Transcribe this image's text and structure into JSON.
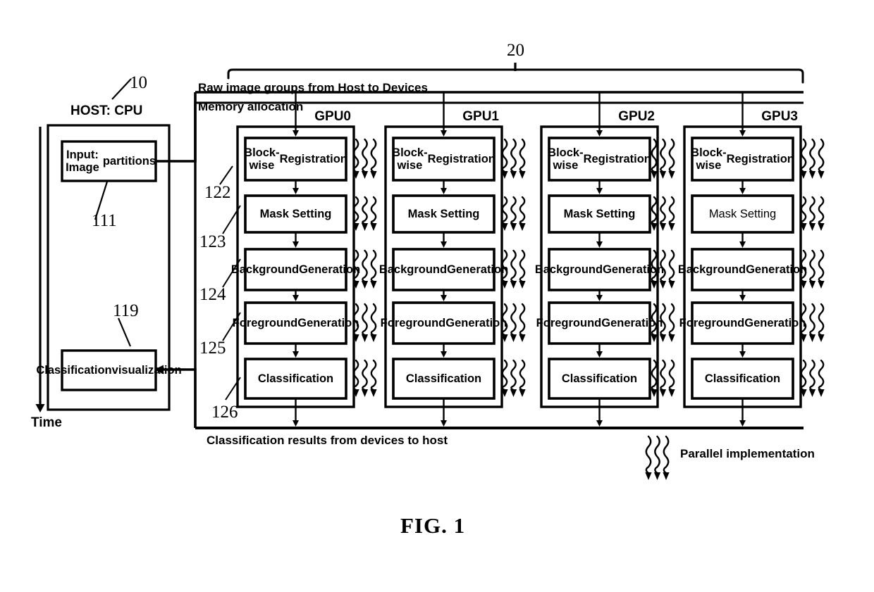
{
  "figure": {
    "caption": "FIG. 1",
    "top_bracket_ref": "20",
    "host_ref": "10"
  },
  "host": {
    "title": "HOST: CPU",
    "time_axis_label": "Time",
    "blocks": [
      {
        "label": "Input: Image\npartitions",
        "ref": "111"
      },
      {
        "label": "Classification\nvisualization",
        "ref": "119"
      }
    ]
  },
  "bus": {
    "top_label": "Raw image groups from Host to Devices",
    "memory_label": "Memory allocation",
    "bottom_label": "Classification results from devices to host"
  },
  "legend": {
    "parallel_label": "Parallel implementation",
    "parallel_icon": "wavy-arrows-icon"
  },
  "stage_refs": [
    "122",
    "123",
    "124",
    "125",
    "126"
  ],
  "gpus": [
    {
      "name": "GPU0",
      "stages": [
        {
          "label": "Block-wise\nRegistration",
          "weight": "bold"
        },
        {
          "label": "Mask Setting",
          "weight": "bold"
        },
        {
          "label": "Background\nGeneration",
          "weight": "bold"
        },
        {
          "label": "Foreground\nGeneration",
          "weight": "bold"
        },
        {
          "label": "Classification",
          "weight": "bold"
        }
      ]
    },
    {
      "name": "GPU1",
      "stages": [
        {
          "label": "Block-wise\nRegistration",
          "weight": "bold"
        },
        {
          "label": "Mask Setting",
          "weight": "bold"
        },
        {
          "label": "Background\nGeneration",
          "weight": "bold"
        },
        {
          "label": "Foreground\nGeneration",
          "weight": "bold"
        },
        {
          "label": "Classification",
          "weight": "bold"
        }
      ]
    },
    {
      "name": "GPU2",
      "stages": [
        {
          "label": "Block-wise\nRegistration",
          "weight": "bold"
        },
        {
          "label": "Mask Setting",
          "weight": "bold"
        },
        {
          "label": "Background\nGeneration",
          "weight": "bold"
        },
        {
          "label": "Foreground\nGeneration",
          "weight": "bold"
        },
        {
          "label": "Classification",
          "weight": "bold"
        }
      ]
    },
    {
      "name": "GPU3",
      "stages": [
        {
          "label": "Block-wise\nRegistration",
          "weight": "bold"
        },
        {
          "label": "Mask Setting",
          "weight": "normal"
        },
        {
          "label": "Background\nGeneration",
          "weight": "bold"
        },
        {
          "label": "Foreground\nGeneration",
          "weight": "bold"
        },
        {
          "label": "Classification",
          "weight": "bold"
        }
      ]
    }
  ],
  "colors": {
    "stroke": "#000000",
    "background": "#ffffff"
  }
}
